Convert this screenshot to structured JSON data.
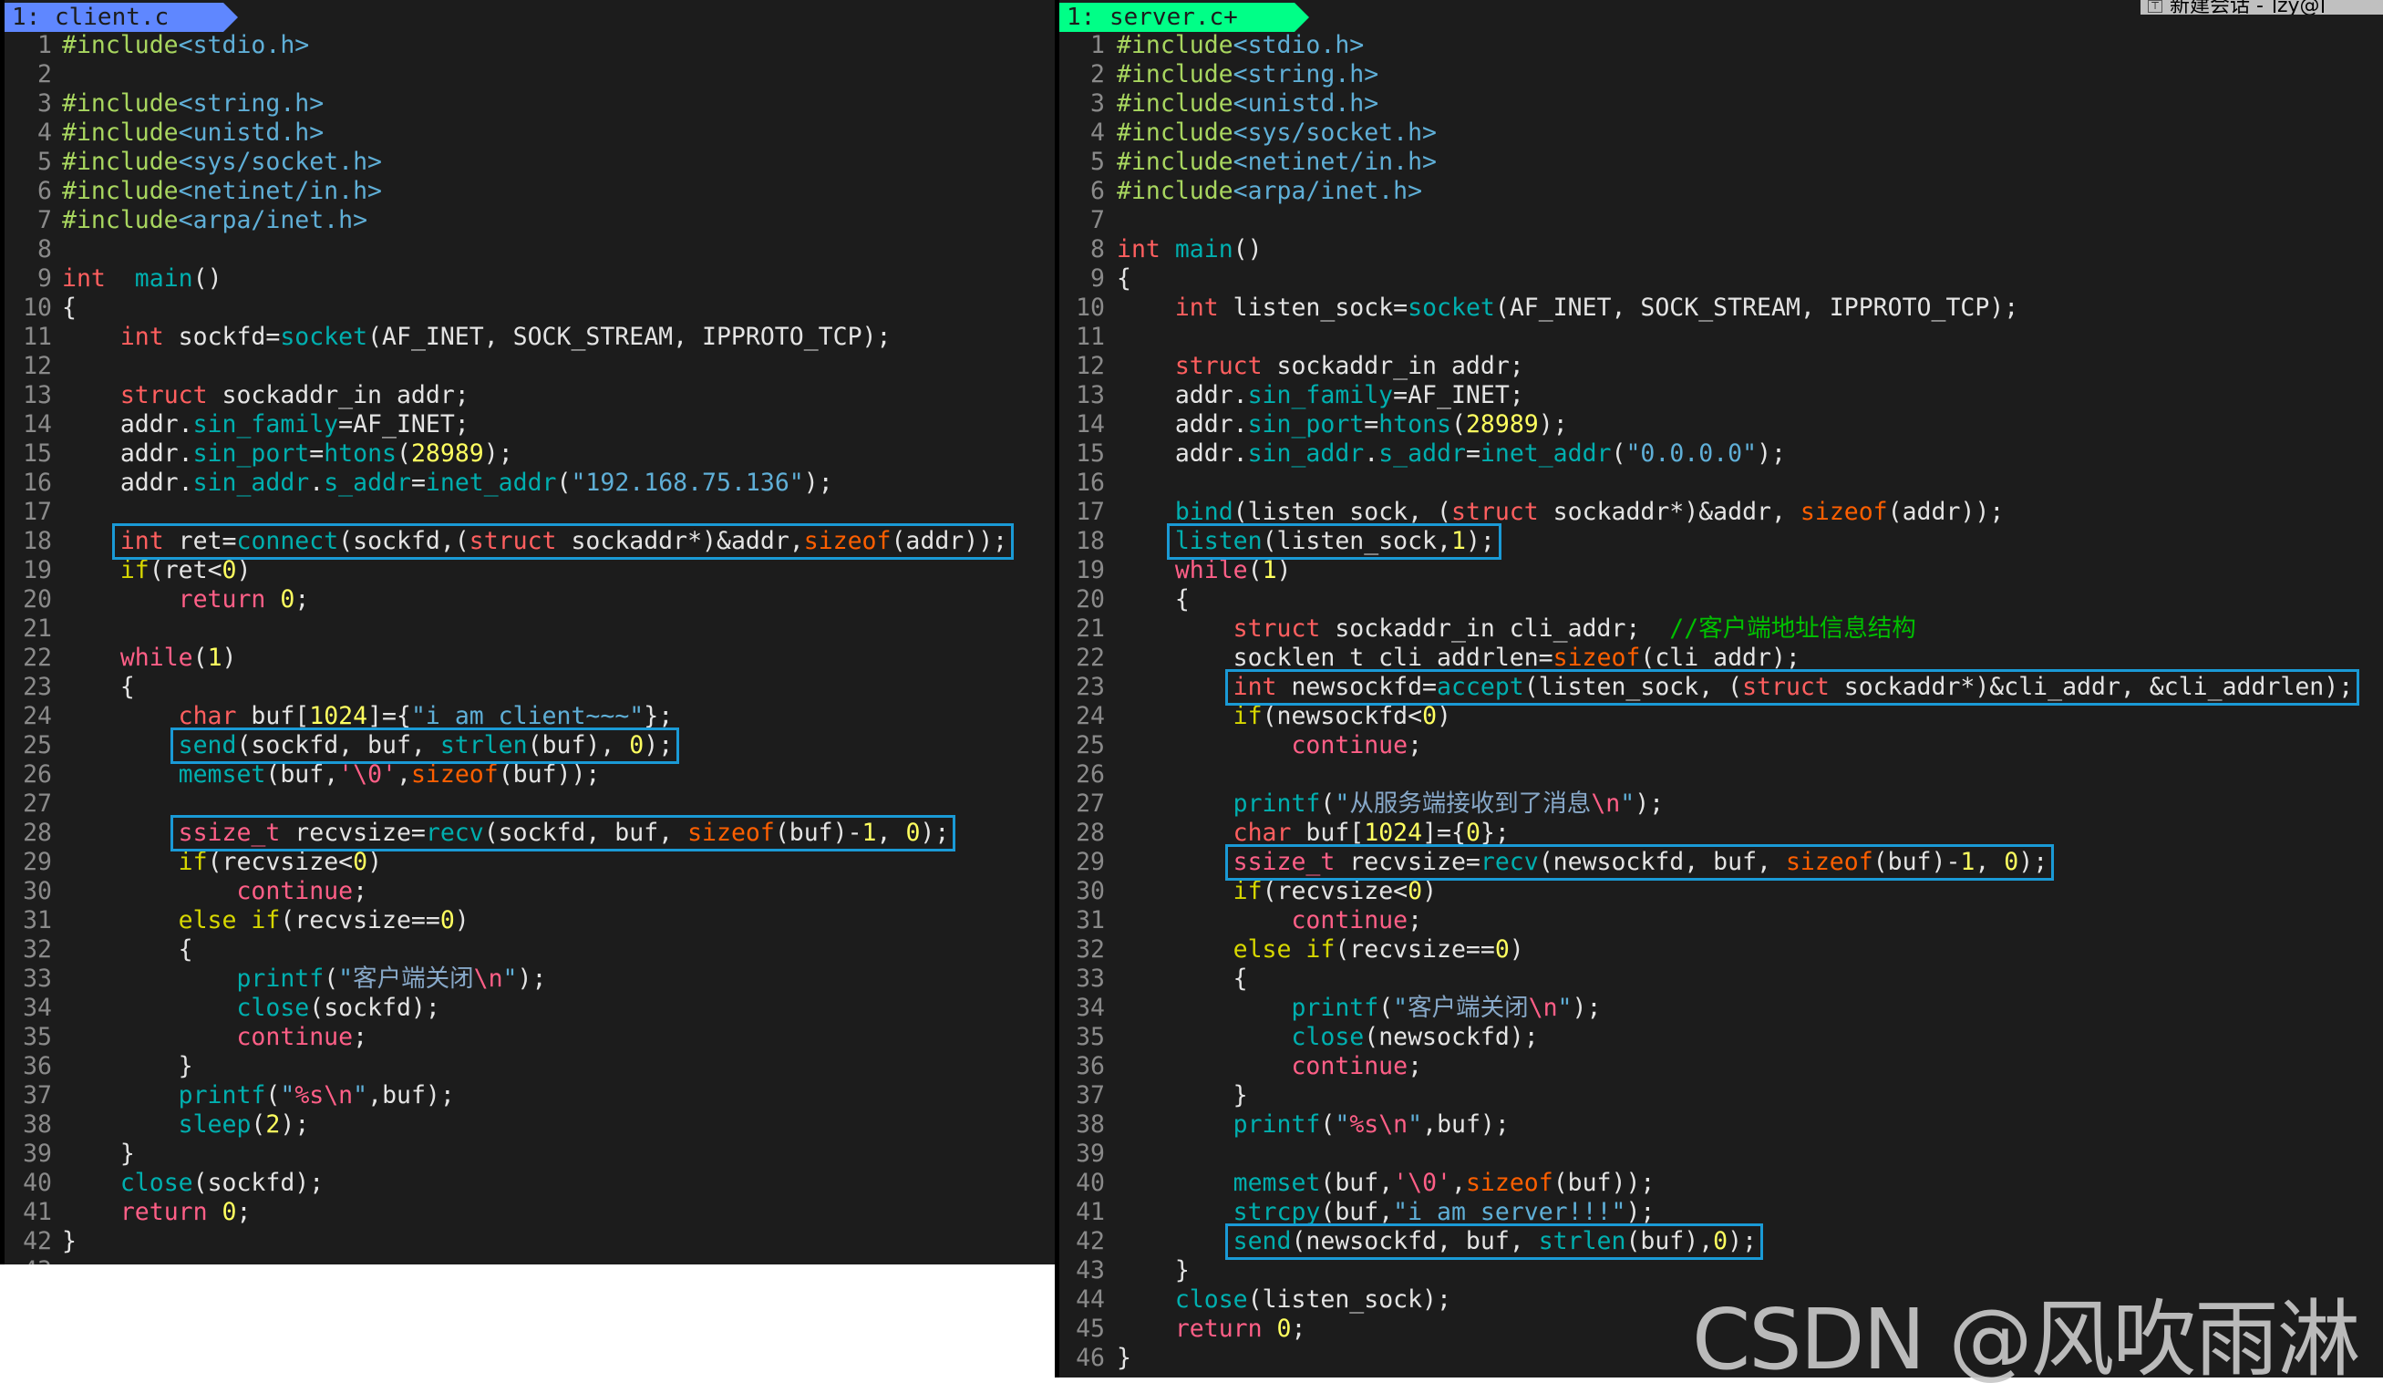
{
  "session_tab": {
    "pin_icon": "pin-icon",
    "title": "新建会话 - ",
    "user": "zy@"
  },
  "client": {
    "tab_label": "1: client.c",
    "lines": [
      [
        [
          "pp",
          "#include"
        ],
        [
          "inc",
          "<stdio.h>"
        ]
      ],
      [],
      [
        [
          "pp",
          "#include"
        ],
        [
          "inc",
          "<string.h>"
        ]
      ],
      [
        [
          "pp",
          "#include"
        ],
        [
          "inc",
          "<unistd.h>"
        ]
      ],
      [
        [
          "pp",
          "#include"
        ],
        [
          "inc",
          "<sys/socket.h>"
        ]
      ],
      [
        [
          "pp",
          "#include"
        ],
        [
          "inc",
          "<netinet/in.h>"
        ]
      ],
      [
        [
          "pp",
          "#include"
        ],
        [
          "inc",
          "<arpa/inet.h>"
        ]
      ],
      [],
      [
        [
          "kw",
          "int"
        ],
        [
          "",
          "  "
        ],
        [
          "fn",
          "main"
        ],
        [
          "",
          "()"
        ]
      ],
      [
        [
          "",
          "{"
        ]
      ],
      [
        [
          "",
          "    "
        ],
        [
          "kw",
          "int"
        ],
        [
          "",
          " sockfd="
        ],
        [
          "fn",
          "socket"
        ],
        [
          "",
          "(AF_INET, SOCK_STREAM, IPPROTO_TCP);"
        ]
      ],
      [],
      [
        [
          "",
          "    "
        ],
        [
          "kw",
          "struct"
        ],
        [
          "",
          " sockaddr_in addr;"
        ]
      ],
      [
        [
          "",
          "    addr."
        ],
        [
          "fn",
          "sin_family"
        ],
        [
          "",
          "=AF_INET;"
        ]
      ],
      [
        [
          "",
          "    addr."
        ],
        [
          "fn",
          "sin_port"
        ],
        [
          "",
          "="
        ],
        [
          "fn",
          "htons"
        ],
        [
          "",
          "("
        ],
        [
          "num",
          "28989"
        ],
        [
          "",
          ");"
        ]
      ],
      [
        [
          "",
          "    addr."
        ],
        [
          "fn",
          "sin_addr"
        ],
        [
          "",
          "."
        ],
        [
          "fn",
          "s_addr"
        ],
        [
          "",
          "="
        ],
        [
          "fn",
          "inet_addr"
        ],
        [
          "",
          "("
        ],
        [
          "str",
          "\"192.168.75.136\""
        ],
        [
          "",
          ");"
        ]
      ],
      [],
      [
        [
          "",
          "    "
        ],
        [
          "kw",
          "int"
        ],
        [
          "",
          " ret="
        ],
        [
          "fn",
          "connect"
        ],
        [
          "",
          "(sockfd,("
        ],
        [
          "kw",
          "struct"
        ],
        [
          "",
          " sockaddr*)&addr,"
        ],
        [
          "sz",
          "sizeof"
        ],
        [
          "",
          "(addr));"
        ]
      ],
      [
        [
          "",
          "    "
        ],
        [
          "cond",
          "if"
        ],
        [
          "",
          "(ret<"
        ],
        [
          "num",
          "0"
        ],
        [
          "",
          ")"
        ]
      ],
      [
        [
          "",
          "        "
        ],
        [
          "fl",
          "return"
        ],
        [
          "",
          " "
        ],
        [
          "num",
          "0"
        ],
        [
          "",
          ";"
        ]
      ],
      [],
      [
        [
          "",
          "    "
        ],
        [
          "fl",
          "while"
        ],
        [
          "",
          "("
        ],
        [
          "num",
          "1"
        ],
        [
          "",
          ")"
        ]
      ],
      [
        [
          "",
          "    {"
        ]
      ],
      [
        [
          "",
          "        "
        ],
        [
          "kw",
          "char"
        ],
        [
          "",
          " buf["
        ],
        [
          "num",
          "1024"
        ],
        [
          "",
          "]={"
        ],
        [
          "str",
          "\"i am client~~~\""
        ],
        [
          "",
          "};"
        ]
      ],
      [
        [
          "",
          "        "
        ],
        [
          "fn",
          "send"
        ],
        [
          "",
          "(sockfd, buf, "
        ],
        [
          "fn",
          "strlen"
        ],
        [
          "",
          "(buf), "
        ],
        [
          "num",
          "0"
        ],
        [
          "",
          ");"
        ]
      ],
      [
        [
          "",
          "        "
        ],
        [
          "fn",
          "memset"
        ],
        [
          "",
          "(buf,"
        ],
        [
          "esc",
          "'\\0'"
        ],
        [
          "",
          ","
        ],
        [
          "sz",
          "sizeof"
        ],
        [
          "",
          "(buf));"
        ]
      ],
      [],
      [
        [
          "",
          "        "
        ],
        [
          "ty",
          "ssize_t"
        ],
        [
          "",
          " recvsize="
        ],
        [
          "fn",
          "recv"
        ],
        [
          "",
          "(sockfd, buf, "
        ],
        [
          "sz",
          "sizeof"
        ],
        [
          "",
          "(buf)-"
        ],
        [
          "num",
          "1"
        ],
        [
          "",
          ", "
        ],
        [
          "num",
          "0"
        ],
        [
          "",
          ");"
        ]
      ],
      [
        [
          "",
          "        "
        ],
        [
          "cond",
          "if"
        ],
        [
          "",
          "(recvsize<"
        ],
        [
          "num",
          "0"
        ],
        [
          "",
          ")"
        ]
      ],
      [
        [
          "",
          "            "
        ],
        [
          "fl",
          "continue"
        ],
        [
          "",
          ";"
        ]
      ],
      [
        [
          "",
          "        "
        ],
        [
          "cond",
          "else if"
        ],
        [
          "",
          "(recvsize=="
        ],
        [
          "num",
          "0"
        ],
        [
          "",
          ")"
        ]
      ],
      [
        [
          "",
          "        {"
        ]
      ],
      [
        [
          "",
          "            "
        ],
        [
          "fn",
          "printf"
        ],
        [
          "",
          "("
        ],
        [
          "str",
          "\""
        ],
        [
          "cjk",
          "客户端关闭"
        ],
        [
          "esc",
          "\\n"
        ],
        [
          "str",
          "\""
        ],
        [
          "",
          ");"
        ]
      ],
      [
        [
          "",
          "            "
        ],
        [
          "fn",
          "close"
        ],
        [
          "",
          "(sockfd);"
        ]
      ],
      [
        [
          "",
          "            "
        ],
        [
          "fl",
          "continue"
        ],
        [
          "",
          ";"
        ]
      ],
      [
        [
          "",
          "        }"
        ]
      ],
      [
        [
          "",
          "        "
        ],
        [
          "fn",
          "printf"
        ],
        [
          "",
          "("
        ],
        [
          "str",
          "\""
        ],
        [
          "esc",
          "%s\\n"
        ],
        [
          "str",
          "\""
        ],
        [
          "",
          ",buf);"
        ]
      ],
      [
        [
          "",
          "        "
        ],
        [
          "fn",
          "sleep"
        ],
        [
          "",
          "("
        ],
        [
          "num",
          "2"
        ],
        [
          "",
          ");"
        ]
      ],
      [
        [
          "",
          "    }"
        ]
      ],
      [
        [
          "",
          "    "
        ],
        [
          "fn",
          "close"
        ],
        [
          "",
          "(sockfd);"
        ]
      ],
      [
        [
          "",
          "    "
        ],
        [
          "fl",
          "return"
        ],
        [
          "",
          " "
        ],
        [
          "num",
          "0"
        ],
        [
          "",
          ";"
        ]
      ],
      [
        [
          "",
          "}"
        ]
      ],
      []
    ],
    "highlights": [
      18,
      25,
      28
    ]
  },
  "server": {
    "tab_label": "1: server.c+",
    "lines": [
      [
        [
          "pp",
          "#include"
        ],
        [
          "inc",
          "<stdio.h>"
        ]
      ],
      [
        [
          "pp",
          "#include"
        ],
        [
          "inc",
          "<string.h>"
        ]
      ],
      [
        [
          "pp",
          "#include"
        ],
        [
          "inc",
          "<unistd.h>"
        ]
      ],
      [
        [
          "pp",
          "#include"
        ],
        [
          "inc",
          "<sys/socket.h>"
        ]
      ],
      [
        [
          "pp",
          "#include"
        ],
        [
          "inc",
          "<netinet/in.h>"
        ]
      ],
      [
        [
          "pp",
          "#include"
        ],
        [
          "inc",
          "<arpa/inet.h>"
        ]
      ],
      [],
      [
        [
          "kw",
          "int"
        ],
        [
          "",
          " "
        ],
        [
          "fn",
          "main"
        ],
        [
          "",
          "()"
        ]
      ],
      [
        [
          "",
          "{"
        ]
      ],
      [
        [
          "",
          "    "
        ],
        [
          "kw",
          "int"
        ],
        [
          "",
          " listen_sock="
        ],
        [
          "fn",
          "socket"
        ],
        [
          "",
          "(AF_INET, SOCK_STREAM, IPPROTO_TCP);"
        ]
      ],
      [],
      [
        [
          "",
          "    "
        ],
        [
          "kw",
          "struct"
        ],
        [
          "",
          " sockaddr_in addr;"
        ]
      ],
      [
        [
          "",
          "    addr."
        ],
        [
          "fn",
          "sin_family"
        ],
        [
          "",
          "=AF_INET;"
        ]
      ],
      [
        [
          "",
          "    addr."
        ],
        [
          "fn",
          "sin_port"
        ],
        [
          "",
          "="
        ],
        [
          "fn",
          "htons"
        ],
        [
          "",
          "("
        ],
        [
          "num",
          "28989"
        ],
        [
          "",
          ");"
        ]
      ],
      [
        [
          "",
          "    addr."
        ],
        [
          "fn",
          "sin_addr"
        ],
        [
          "",
          "."
        ],
        [
          "fn",
          "s_addr"
        ],
        [
          "",
          "="
        ],
        [
          "fn",
          "inet_addr"
        ],
        [
          "",
          "("
        ],
        [
          "str",
          "\"0.0.0.0\""
        ],
        [
          "",
          ");"
        ]
      ],
      [],
      [
        [
          "",
          "    "
        ],
        [
          "fn",
          "bind"
        ],
        [
          "",
          "(listen_sock, ("
        ],
        [
          "kw",
          "struct"
        ],
        [
          "",
          " sockaddr*)&addr, "
        ],
        [
          "sz",
          "sizeof"
        ],
        [
          "",
          "(addr));"
        ]
      ],
      [
        [
          "",
          "    "
        ],
        [
          "fn",
          "listen"
        ],
        [
          "",
          "(listen_sock,"
        ],
        [
          "num",
          "1"
        ],
        [
          "",
          ");"
        ]
      ],
      [
        [
          "",
          "    "
        ],
        [
          "fl",
          "while"
        ],
        [
          "",
          "("
        ],
        [
          "num",
          "1"
        ],
        [
          "",
          ")"
        ]
      ],
      [
        [
          "",
          "    {"
        ]
      ],
      [
        [
          "",
          "        "
        ],
        [
          "kw",
          "struct"
        ],
        [
          "",
          " sockaddr_in cli_addr;  "
        ],
        [
          "cmt",
          "//客户端地址信息结构"
        ]
      ],
      [
        [
          "",
          "        socklen_t cli_addrlen="
        ],
        [
          "sz",
          "sizeof"
        ],
        [
          "",
          "(cli_addr);"
        ]
      ],
      [
        [
          "",
          "        "
        ],
        [
          "kw",
          "int"
        ],
        [
          "",
          " newsockfd="
        ],
        [
          "fn",
          "accept"
        ],
        [
          "",
          "(listen_sock, ("
        ],
        [
          "kw",
          "struct"
        ],
        [
          "",
          " sockaddr*)&cli_addr, &cli_addrlen);"
        ]
      ],
      [
        [
          "",
          "        "
        ],
        [
          "cond",
          "if"
        ],
        [
          "",
          "(newsockfd<"
        ],
        [
          "num",
          "0"
        ],
        [
          "",
          ")"
        ]
      ],
      [
        [
          "",
          "            "
        ],
        [
          "fl",
          "continue"
        ],
        [
          "",
          ";"
        ]
      ],
      [],
      [
        [
          "",
          "        "
        ],
        [
          "fn",
          "printf"
        ],
        [
          "",
          "("
        ],
        [
          "str",
          "\""
        ],
        [
          "cjk",
          "从服务端接收到了消息"
        ],
        [
          "esc",
          "\\n"
        ],
        [
          "str",
          "\""
        ],
        [
          "",
          ");"
        ]
      ],
      [
        [
          "",
          "        "
        ],
        [
          "kw",
          "char"
        ],
        [
          "",
          " buf["
        ],
        [
          "num",
          "1024"
        ],
        [
          "",
          "]={"
        ],
        [
          "num",
          "0"
        ],
        [
          "",
          "};"
        ]
      ],
      [
        [
          "",
          "        "
        ],
        [
          "ty",
          "ssize_t"
        ],
        [
          "",
          " recvsize="
        ],
        [
          "fn",
          "recv"
        ],
        [
          "",
          "(newsockfd, buf, "
        ],
        [
          "sz",
          "sizeof"
        ],
        [
          "",
          "(buf)-"
        ],
        [
          "num",
          "1"
        ],
        [
          "",
          ", "
        ],
        [
          "num",
          "0"
        ],
        [
          "",
          ");"
        ]
      ],
      [
        [
          "",
          "        "
        ],
        [
          "cond",
          "if"
        ],
        [
          "",
          "(recvsize<"
        ],
        [
          "num",
          "0"
        ],
        [
          "",
          ")"
        ]
      ],
      [
        [
          "",
          "            "
        ],
        [
          "fl",
          "continue"
        ],
        [
          "",
          ";"
        ]
      ],
      [
        [
          "",
          "        "
        ],
        [
          "cond",
          "else if"
        ],
        [
          "",
          "(recvsize=="
        ],
        [
          "num",
          "0"
        ],
        [
          "",
          ")"
        ]
      ],
      [
        [
          "",
          "        {"
        ]
      ],
      [
        [
          "",
          "            "
        ],
        [
          "fn",
          "printf"
        ],
        [
          "",
          "("
        ],
        [
          "str",
          "\""
        ],
        [
          "cjk",
          "客户端关闭"
        ],
        [
          "esc",
          "\\n"
        ],
        [
          "str",
          "\""
        ],
        [
          "",
          ");"
        ]
      ],
      [
        [
          "",
          "            "
        ],
        [
          "fn",
          "close"
        ],
        [
          "",
          "(newsockfd);"
        ]
      ],
      [
        [
          "",
          "            "
        ],
        [
          "fl",
          "continue"
        ],
        [
          "",
          ";"
        ]
      ],
      [
        [
          "",
          "        }"
        ]
      ],
      [
        [
          "",
          "        "
        ],
        [
          "fn",
          "printf"
        ],
        [
          "",
          "("
        ],
        [
          "str",
          "\""
        ],
        [
          "esc",
          "%s\\n"
        ],
        [
          "str",
          "\""
        ],
        [
          "",
          ",buf);"
        ]
      ],
      [],
      [
        [
          "",
          "        "
        ],
        [
          "fn",
          "memset"
        ],
        [
          "",
          "(buf,"
        ],
        [
          "esc",
          "'\\0'"
        ],
        [
          "",
          ","
        ],
        [
          "sz",
          "sizeof"
        ],
        [
          "",
          "(buf));"
        ]
      ],
      [
        [
          "",
          "        "
        ],
        [
          "fn",
          "strcpy"
        ],
        [
          "",
          "(buf,"
        ],
        [
          "str",
          "\"i am server!!!\""
        ],
        [
          "",
          ");"
        ]
      ],
      [
        [
          "",
          "        "
        ],
        [
          "fn",
          "send"
        ],
        [
          "",
          "(newsockfd, buf, "
        ],
        [
          "fn",
          "strlen"
        ],
        [
          "",
          "(buf),"
        ],
        [
          "num",
          "0"
        ],
        [
          "",
          ");"
        ]
      ],
      [
        [
          "",
          "    }"
        ]
      ],
      [
        [
          "",
          "    "
        ],
        [
          "fn",
          "close"
        ],
        [
          "",
          "(listen_sock);"
        ]
      ],
      [
        [
          "",
          "    "
        ],
        [
          "fl",
          "return"
        ],
        [
          "",
          " "
        ],
        [
          "num",
          "0"
        ],
        [
          "",
          ";"
        ]
      ],
      [
        [
          "",
          "}"
        ]
      ]
    ],
    "highlights": [
      18,
      23,
      29,
      42
    ]
  },
  "watermark": "CSDN @风吹雨淋"
}
